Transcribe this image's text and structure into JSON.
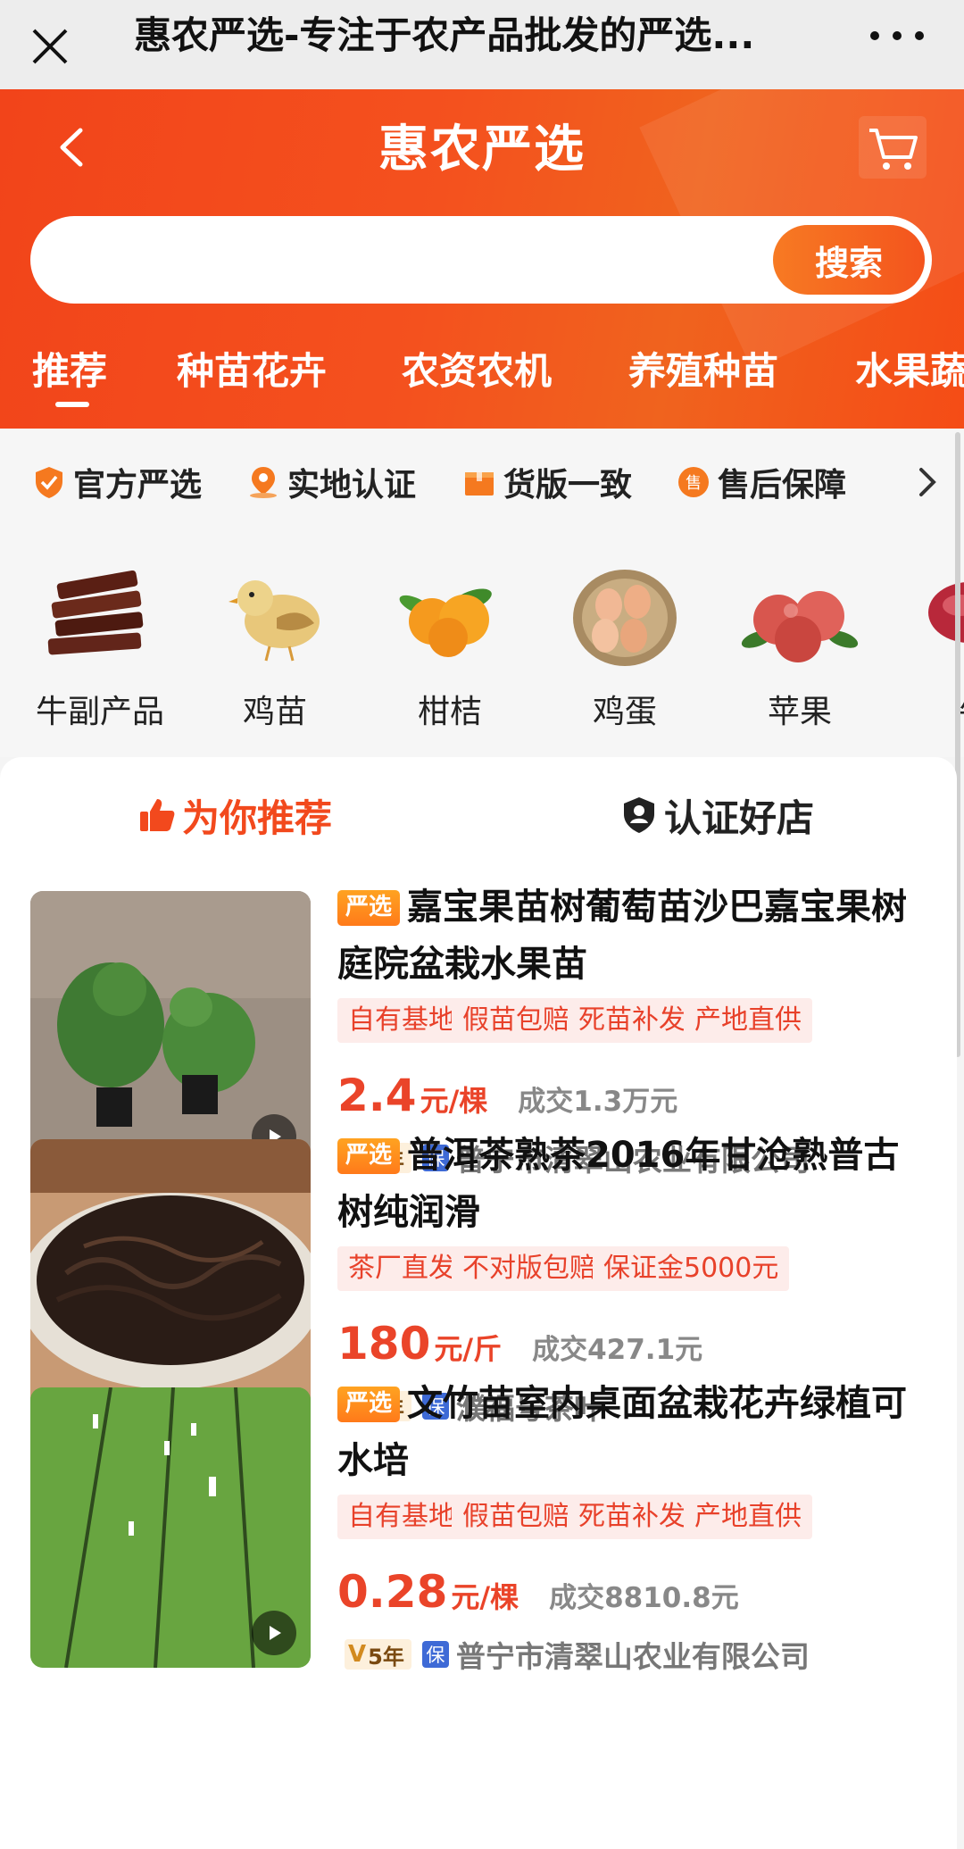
{
  "topbar": {
    "title": "惠农严选-专注于农产品批发的严选..."
  },
  "header": {
    "brand": "惠农严选",
    "search_placeholder": "",
    "search_button": "搜索"
  },
  "category_tabs": [
    {
      "label": "推荐"
    },
    {
      "label": "种苗花卉"
    },
    {
      "label": "农资农机"
    },
    {
      "label": "养殖种苗"
    },
    {
      "label": "水果蔬"
    }
  ],
  "guarantees": [
    {
      "label": "官方严选",
      "icon": "shield-check-icon"
    },
    {
      "label": "实地认证",
      "icon": "location-user-icon"
    },
    {
      "label": "货版一致",
      "icon": "box-icon"
    },
    {
      "label": "售后保障",
      "icon": "after-sale-icon",
      "icon_text": "售"
    }
  ],
  "categories": [
    {
      "label": "牛副产品",
      "icon": "beef-jerky-icon"
    },
    {
      "label": "鸡苗",
      "icon": "chick-icon"
    },
    {
      "label": "柑桔",
      "icon": "tangerine-icon"
    },
    {
      "label": "鸡蛋",
      "icon": "eggs-icon"
    },
    {
      "label": "苹果",
      "icon": "apples-icon"
    },
    {
      "label": "牛",
      "icon": "beef-icon"
    }
  ],
  "rec_tabs": {
    "recommend": "为你推荐",
    "certified": "认证好店"
  },
  "products": [
    {
      "badge": "严选",
      "title": "嘉宝果苗树葡萄苗沙巴嘉宝果树庭院盆栽水果苗",
      "tags": [
        "自有基地",
        "假苗包赔",
        "死苗补发",
        "产地直供"
      ],
      "price": "2.4",
      "unit": "元/棵",
      "deal": "成交1.3万元",
      "years": "5年",
      "bao": "保",
      "shop": "普宁市清翠山农业有限公司",
      "has_video": true
    },
    {
      "badge": "严选",
      "title": "普洱茶熟茶2016年甘沧熟普古树纯润滑",
      "tags": [
        "茶厂直发",
        "不对版包赔",
        "保证金5000元"
      ],
      "price": "180",
      "unit": "元/斤",
      "deal": "成交427.1元",
      "years": "1年",
      "bao": "保",
      "shop": "濮福号茶叶",
      "has_video": false
    },
    {
      "badge": "严选",
      "title": "文竹苗室内桌面盆栽花卉绿植可水培",
      "tags": [
        "自有基地",
        "假苗包赔",
        "死苗补发",
        "产地直供"
      ],
      "price": "0.28",
      "unit": "元/棵",
      "deal": "成交8810.8元",
      "years": "5年",
      "bao": "保",
      "shop": "普宁市清翠山农业有限公司",
      "has_video": true
    }
  ],
  "colors": {
    "brand_orange": "#f4511e",
    "price_red": "#ea4429",
    "tag_bg": "#fdecea"
  }
}
